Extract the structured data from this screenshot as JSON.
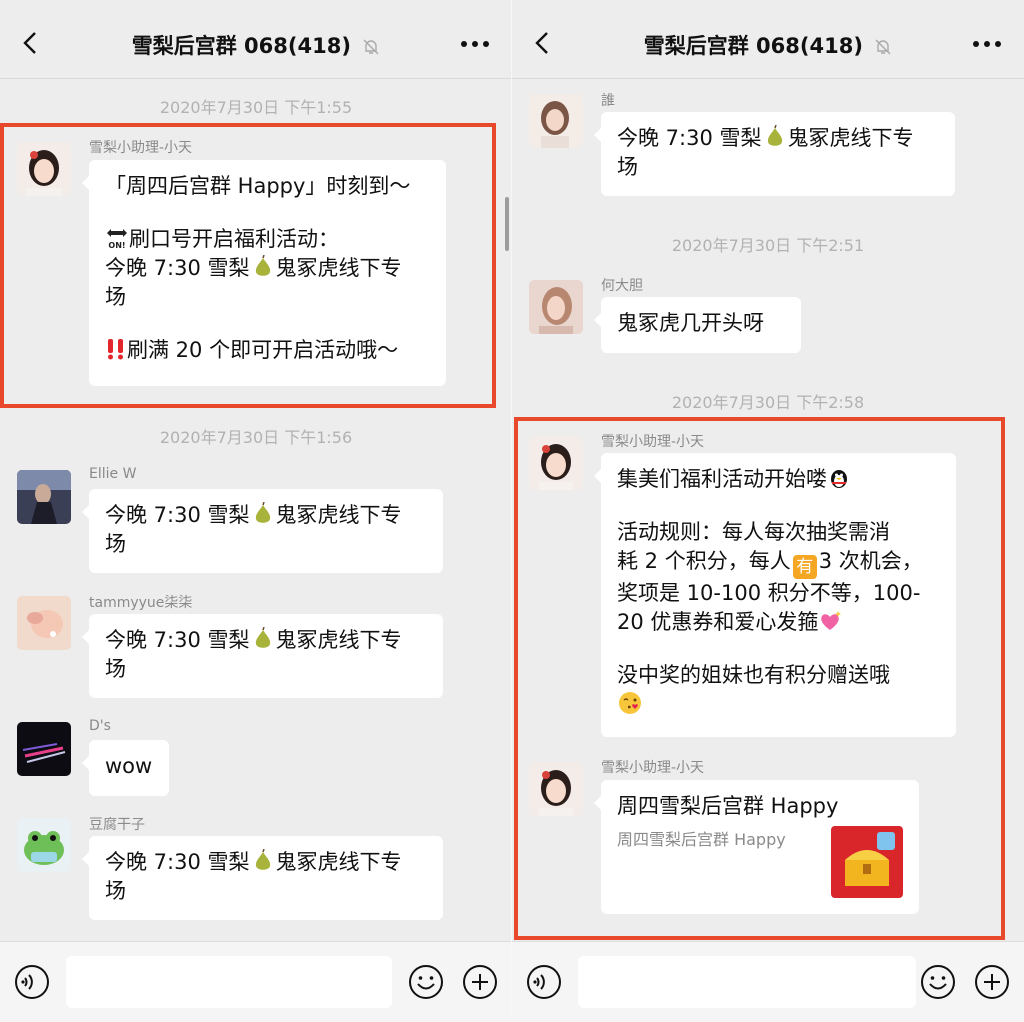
{
  "left": {
    "title": "雪梨后宫群 068(418)",
    "timestamps": [
      "2020年7月30日 下午1:55",
      "2020年7月30日 下午1:56"
    ],
    "messages": [
      {
        "sender": "雪梨小助理-小天",
        "lines": [
          "「周四后宫群 Happy」时刻到～",
          "刷口号开启福利活动：",
          "今晚 7:30 雪梨",
          "鬼冢虎线下专",
          "场",
          "刷满 20 个即可开启活动哦～"
        ]
      },
      {
        "sender": "Ellie W",
        "line1a": "今晚 7:30 雪梨",
        "line1b": "鬼冢虎线下专",
        "line2": "场"
      },
      {
        "sender": "tammyyue柒柒",
        "line1a": "今晚 7:30 雪梨",
        "line1b": "鬼冢虎线下专",
        "line2": "场"
      },
      {
        "sender": "D's",
        "text": "wow"
      },
      {
        "sender": "豆腐干子",
        "line1a": "今晚 7:30 雪梨",
        "line1b": "鬼冢虎线下专",
        "line2": "场"
      }
    ]
  },
  "right": {
    "title": "雪梨后宫群 068(418)",
    "timestamps": [
      "2020年7月30日 下午2:51",
      "2020年7月30日 下午2:58"
    ],
    "messages": [
      {
        "sender": "誰",
        "line1a": "今晚 7:30 雪梨",
        "line1b": "鬼冢虎线下专",
        "line2": "场"
      },
      {
        "sender": "何大胆",
        "text": "鬼冢虎几开头呀"
      },
      {
        "sender": "雪梨小助理-小天",
        "l1": "集美们福利活动开始喽",
        "l2": "活动规则：每人每次抽奖需消",
        "l3a": "耗 2 个积分，每人",
        "l3b": "有",
        "l3c": "3 次机会，",
        "l4": "奖项是 10-100 积分不等，100-",
        "l5": "20 优惠券和爱心发箍",
        "l6": "没中奖的姐妹也有积分赠送哦"
      },
      {
        "sender": "雪梨小助理-小天",
        "card_title": "周四雪梨后宫群 Happy",
        "card_sub": "周四雪梨后宫群 Happy"
      }
    ]
  },
  "icons": [
    "back-icon",
    "mute-bell-icon",
    "more-icon",
    "voice-icon",
    "emoji-icon",
    "plus-icon",
    "pear-emoji",
    "on-arrow-emoji",
    "double-exclamation-emoji",
    "penguin-emoji",
    "you-badge-emoji",
    "sparkling-heart-emoji",
    "kiss-emoji",
    "treasure-chest-image"
  ],
  "colors": {
    "highlight_border": "#e8482b",
    "background": "#ededed",
    "bubble": "#ffffff"
  }
}
